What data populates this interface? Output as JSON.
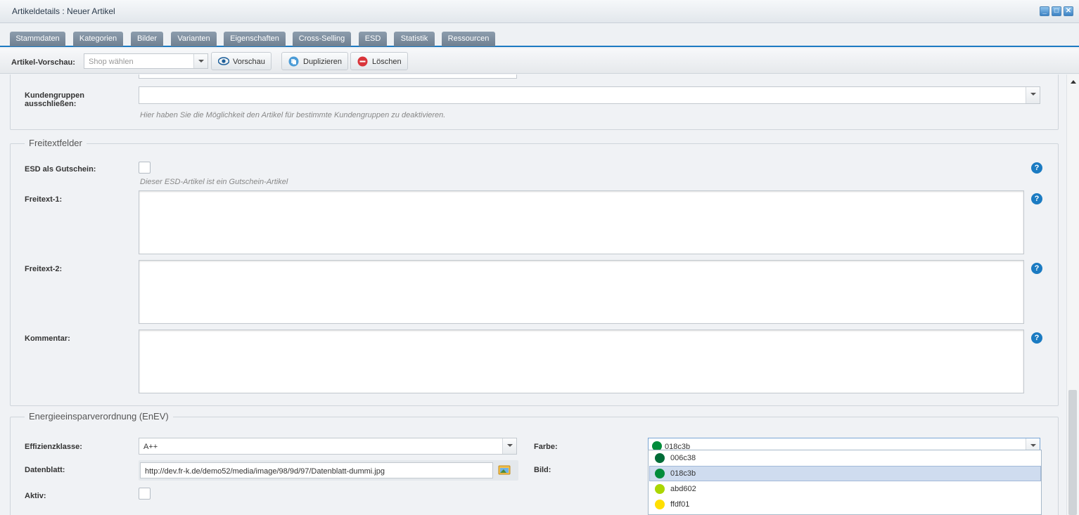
{
  "window": {
    "title": "Artikeldetails : Neuer Artikel"
  },
  "tabs": [
    {
      "label": "Stammdaten",
      "state": "active"
    },
    {
      "label": "Kategorien",
      "state": "normal"
    },
    {
      "label": "Bilder",
      "state": "normal"
    },
    {
      "label": "Varianten",
      "state": "disabled"
    },
    {
      "label": "Eigenschaften",
      "state": "normal"
    },
    {
      "label": "Cross-Selling",
      "state": "normal"
    },
    {
      "label": "ESD",
      "state": "disabled"
    },
    {
      "label": "Statistik",
      "state": "disabled"
    },
    {
      "label": "Ressourcen",
      "state": "normal"
    }
  ],
  "toolbar": {
    "preview_label": "Artikel-Vorschau:",
    "shop_placeholder": "Shop wählen",
    "preview_button": "Vorschau",
    "duplicate_button": "Duplizieren",
    "delete_button": "Löschen"
  },
  "customer_groups": {
    "label_line1": "Kundengruppen",
    "label_line2": "ausschließen:",
    "help": "Hier haben Sie die Möglichkeit den Artikel für bestimmte Kundengruppen zu deaktivieren."
  },
  "freetext": {
    "legend": "Freitextfelder",
    "esd_label": "ESD als Gutschein:",
    "esd_help": "Dieser ESD-Artikel ist ein Gutschein-Artikel",
    "freitext1_label": "Freitext-1:",
    "freitext2_label": "Freitext-2:",
    "comment_label": "Kommentar:"
  },
  "enev": {
    "legend": "Energieeinsparverordnung (EnEV)",
    "class_label": "Effizienzklasse:",
    "class_value": "A++",
    "datasheet_label": "Datenblatt:",
    "datasheet_value": "http://dev.fr-k.de/demo52/media/image/98/9d/97/Datenblatt-dummi.jpg",
    "active_label": "Aktiv:",
    "color_label": "Farbe:",
    "color_value": "018c3b",
    "color_value_hex": "#018c3b",
    "image_label": "Bild:"
  },
  "color_options": [
    {
      "label": "006c38",
      "hex": "#006c38",
      "selected": false
    },
    {
      "label": "018c3b",
      "hex": "#018c3b",
      "selected": true
    },
    {
      "label": "abd602",
      "hex": "#abd602",
      "selected": false
    },
    {
      "label": "ffdf01",
      "hex": "#ffdf01",
      "selected": false
    },
    {
      "label": "",
      "hex": "#e9a400",
      "selected": false
    }
  ],
  "help_icon": "question-mark-icon",
  "colors": {
    "accent": "#1c7ac2",
    "tab_active": "#2b8fd8",
    "tab_normal": "#7e8e9f"
  }
}
